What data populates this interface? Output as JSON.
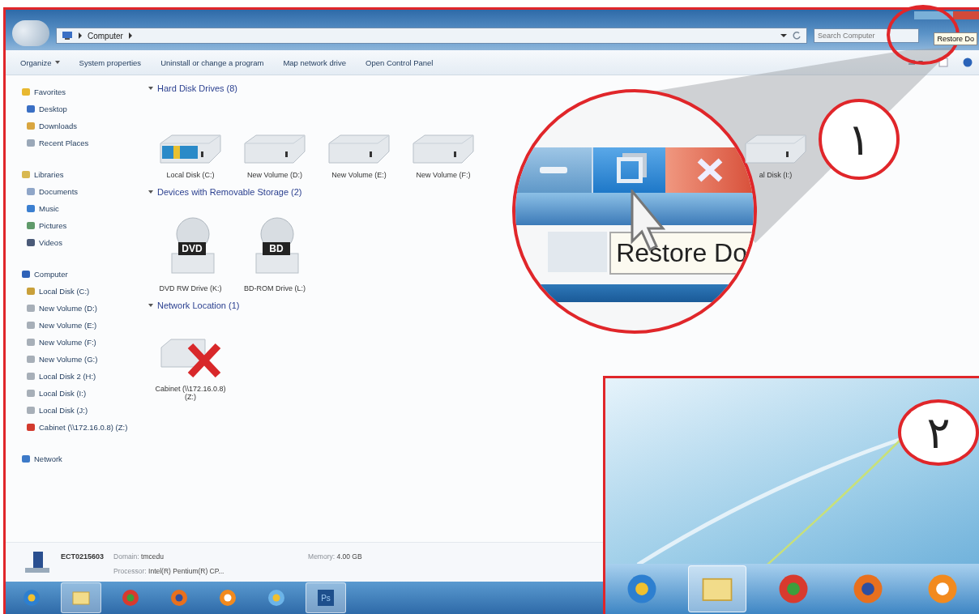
{
  "window": {
    "breadcrumb": "Computer",
    "search": {
      "placeholder": "Search Computer"
    },
    "tooltip": "Restore Do"
  },
  "toolbar": [
    {
      "label": "Organize",
      "dropdown": true
    },
    {
      "label": "System properties",
      "dropdown": false
    },
    {
      "label": "Uninstall or change a program",
      "dropdown": false
    },
    {
      "label": "Map network drive",
      "dropdown": false
    },
    {
      "label": "Open Control Panel",
      "dropdown": false
    }
  ],
  "nav": [
    {
      "label": "Favorites",
      "kind": "star",
      "children": [
        {
          "label": "Desktop",
          "kind": "desktop"
        },
        {
          "label": "Downloads",
          "kind": "downloads"
        },
        {
          "label": "Recent Places",
          "kind": "recent"
        }
      ]
    },
    {
      "label": "Libraries",
      "kind": "libraries",
      "children": [
        {
          "label": "Documents",
          "kind": "document"
        },
        {
          "label": "Music",
          "kind": "music"
        },
        {
          "label": "Pictures",
          "kind": "picture"
        },
        {
          "label": "Videos",
          "kind": "video"
        }
      ]
    },
    {
      "label": "Computer",
      "kind": "computer",
      "children": [
        {
          "label": "Local Disk (C:)",
          "kind": "system-drive"
        },
        {
          "label": "New Volume (D:)",
          "kind": "drive"
        },
        {
          "label": "New Volume (E:)",
          "kind": "drive"
        },
        {
          "label": "New Volume (F:)",
          "kind": "drive"
        },
        {
          "label": "New Volume (G:)",
          "kind": "drive"
        },
        {
          "label": "Local Disk 2 (H:)",
          "kind": "drive"
        },
        {
          "label": "Local Disk (I:)",
          "kind": "drive"
        },
        {
          "label": "Local Disk (J:)",
          "kind": "drive"
        },
        {
          "label": "Cabinet (\\\\172.16.0.8) (Z:)",
          "kind": "network-drive"
        }
      ]
    },
    {
      "label": "Network",
      "kind": "network"
    }
  ],
  "sections": [
    {
      "title": "Hard Disk Drives (8)",
      "items": [
        {
          "label": "Local Disk (C:)",
          "kind": "system-hdd"
        },
        {
          "label": "New Volume (D:)",
          "kind": "hdd"
        },
        {
          "label": "New Volume (E:)",
          "kind": "hdd"
        },
        {
          "label": "New Volume (F:)",
          "kind": "hdd"
        },
        {
          "label": "al Disk (I:)",
          "kind": "hdd"
        }
      ]
    },
    {
      "title": "Devices with Removable Storage (2)",
      "items": [
        {
          "label": "DVD RW Drive (K:)",
          "kind": "optical",
          "badge": "DVD"
        },
        {
          "label": "BD-ROM Drive (L:)",
          "kind": "optical",
          "badge": "BD"
        }
      ]
    },
    {
      "title": "Network Location (1)",
      "items": [
        {
          "label": "Cabinet (\\\\172.16.0.8) (Z:)",
          "kind": "network-disconnected"
        }
      ]
    }
  ],
  "details": {
    "name": "ECT0215603",
    "fields": [
      {
        "label": "Domain:",
        "value": "tmcedu"
      },
      {
        "label": "Memory:",
        "value": "4.00 GB"
      },
      {
        "label": "Processor:",
        "value": "Intel(R) Pentium(R) CP..."
      }
    ]
  },
  "taskbar": [
    {
      "kind": "start",
      "open": false
    },
    {
      "kind": "explorer",
      "open": true
    },
    {
      "kind": "chrome",
      "open": false
    },
    {
      "kind": "firefox",
      "open": false
    },
    {
      "kind": "media",
      "open": false
    },
    {
      "kind": "ie",
      "open": false
    },
    {
      "kind": "photoshop",
      "open": true,
      "label": "Ps"
    }
  ],
  "callout": {
    "badge": "١",
    "tooltip": "Restore Do"
  },
  "inset": {
    "badge": "٢",
    "taskbar": [
      {
        "kind": "start",
        "open": false
      },
      {
        "kind": "explorer",
        "open": true
      },
      {
        "kind": "chrome",
        "open": false
      },
      {
        "kind": "firefox",
        "open": false
      },
      {
        "kind": "media",
        "open": false
      }
    ]
  }
}
